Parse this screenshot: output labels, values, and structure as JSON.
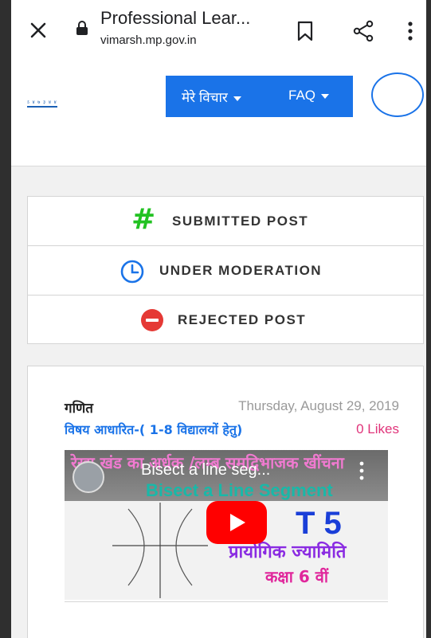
{
  "browser": {
    "page_title": "Professional Lear...",
    "url": "vimarsh.mp.gov.in"
  },
  "site": {
    "logo_text": "ऽ ४ ७ ३ ४ ४",
    "nav": {
      "my_thoughts": "मेरे विचार",
      "faq": "FAQ"
    }
  },
  "status_panel": {
    "submitted": "SUBMITTED POST",
    "under_moderation": "UNDER MODERATION",
    "rejected": "REJECTED POST"
  },
  "post": {
    "subject": "गणित",
    "date": "Thursday, August 29, 2019",
    "category": "विषय आधारित-( 1-8 विद्यालयों हेतु)",
    "likes": "0 Likes",
    "video": {
      "title": "Bisect a line seg...",
      "thumb_top_hindi": "रेखा खंड का अर्धक /लम्ब समद्विभाजक खींचना",
      "thumb_bisect": "Bisect a Line Segment",
      "thumb_number": "T 5",
      "thumb_hindi_1": "प्रायोगिक ज्यामिति",
      "thumb_hindi_2": "कक्षा 6 वीं"
    }
  },
  "colors": {
    "nav_blue": "#1a73e8",
    "hash_green": "#22c222",
    "likes_pink": "#e0347a",
    "reject_red": "#e53935"
  }
}
